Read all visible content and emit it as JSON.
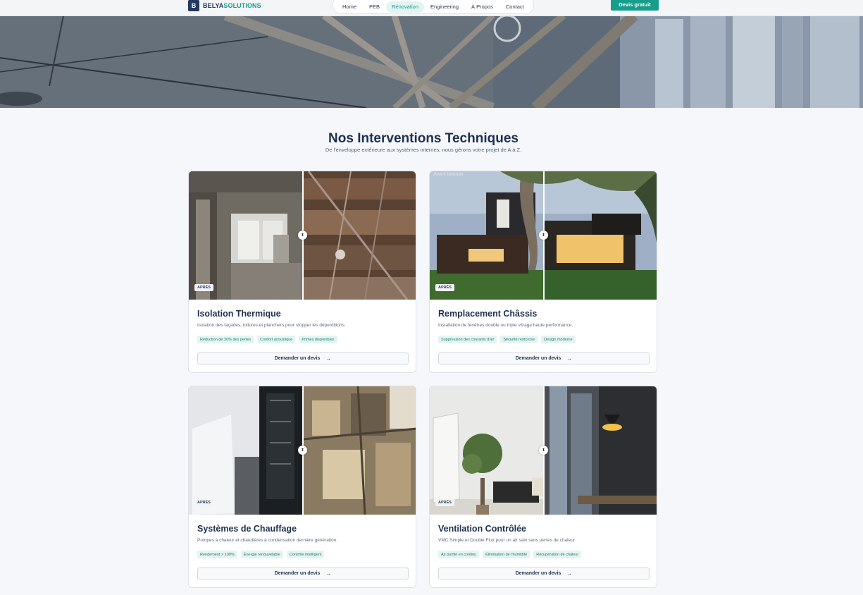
{
  "brand": {
    "mark": "B",
    "name_primary": "BELYA",
    "name_accent": "SOLUTIONS"
  },
  "nav": [
    {
      "label": "Home"
    },
    {
      "label": "PEB"
    },
    {
      "label": "Rénovation",
      "active": true
    },
    {
      "label": "Engineering"
    },
    {
      "label": "À Propos"
    },
    {
      "label": "Contact"
    }
  ],
  "cta_label": "Devis gratuit",
  "section": {
    "title": "Nos Interventions Techniques",
    "subtitle": "De l'enveloppe extérieure aux systèmes internes, nous gérons votre projet de A à Z."
  },
  "cards": [
    {
      "badge": "APRÈS",
      "title": "Isolation Thermique",
      "description": "Isolation des façades, toitures et planchers pour stopper les déperditions.",
      "tags": [
        "Réduction de 30% des pertes",
        "Confort acoustique",
        "Primes disponibles"
      ],
      "button": "Demander un devis"
    },
    {
      "badge": "APRÈS",
      "image_alt": "Avant travaux",
      "title": "Remplacement Châssis",
      "description": "Installation de fenêtres double ou triple vitrage haute performance.",
      "tags": [
        "Suppression des courants d'air",
        "Sécurité renforcée",
        "Design moderne"
      ],
      "button": "Demander un devis"
    },
    {
      "badge": "APRÈS",
      "title": "Systèmes de Chauffage",
      "description": "Pompes à chaleur et chaudières à condensation dernière génération.",
      "tags": [
        "Rendement > 100%",
        "Énergie renouvelable",
        "Contrôle intelligent"
      ],
      "button": "Demander un devis"
    },
    {
      "badge": "APRÈS",
      "title": "Ventilation Contrôlée",
      "description": "VMC Simple et Double Flux pour un air sain sans pertes de chaleur.",
      "tags": [
        "Air purifié en continu",
        "Élimination de l'humidité",
        "Récupération de chaleur"
      ],
      "button": "Demander un devis"
    }
  ],
  "colors": {
    "navy": "#1e3050",
    "teal": "#169e8c",
    "background": "#f5f7fa"
  },
  "icons": {
    "compare_handle": "double-chevron-icon",
    "button_arrow": "arrow-right-icon"
  }
}
